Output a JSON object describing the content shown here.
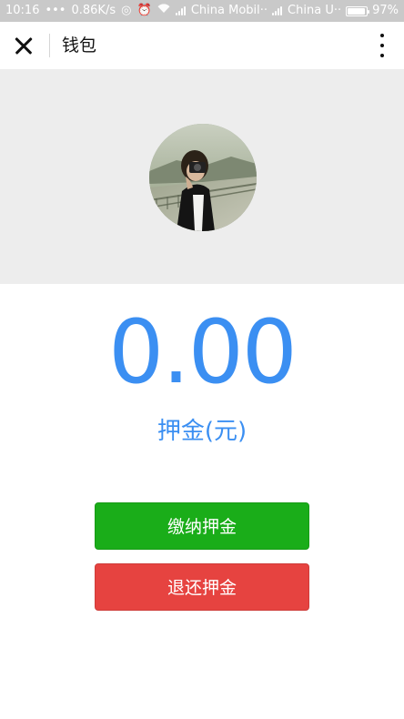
{
  "status_bar": {
    "time": "10:16",
    "dots": "•••",
    "speed": "0.86K/s",
    "carrier1": "China Mobil··",
    "carrier2": "China U··",
    "battery_text": "97%",
    "battery_level": 0.97
  },
  "titlebar": {
    "title": "钱包"
  },
  "wallet": {
    "amount": "0.00",
    "amount_label": "押金(元)"
  },
  "actions": {
    "pay_deposit": "缴纳押金",
    "refund_deposit": "退还押金"
  },
  "colors": {
    "accent_blue": "#3b8ff2",
    "primary_green": "#1aad19",
    "danger_red": "#e64340",
    "header_gray": "#ededed"
  },
  "icons": {
    "close": "close-icon",
    "more": "more-vertical-icon",
    "avatar": "user-avatar-photo"
  }
}
